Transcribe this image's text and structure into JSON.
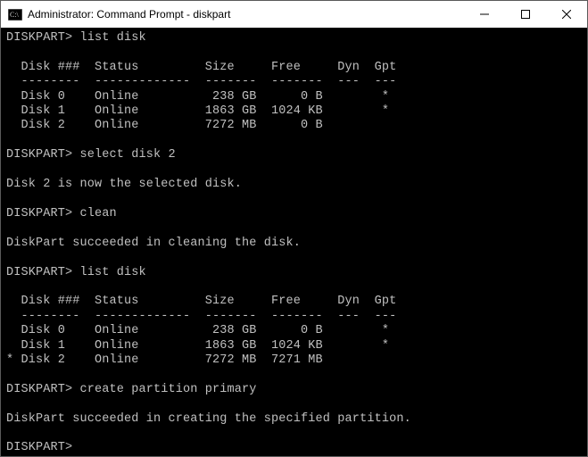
{
  "window": {
    "title": "Administrator: Command Prompt - diskpart"
  },
  "prompt": "DISKPART>",
  "session": {
    "cmd1": "list disk",
    "table1": {
      "header": "  Disk ###  Status         Size     Free     Dyn  Gpt",
      "divider": "  --------  -------------  -------  -------  ---  ---",
      "rows": [
        "  Disk 0    Online          238 GB      0 B        *",
        "  Disk 1    Online         1863 GB  1024 KB        *",
        "  Disk 2    Online         7272 MB      0 B"
      ]
    },
    "cmd2": "select disk 2",
    "msg2": "Disk 2 is now the selected disk.",
    "cmd3": "clean",
    "msg3": "DiskPart succeeded in cleaning the disk.",
    "cmd4": "list disk",
    "table2": {
      "header": "  Disk ###  Status         Size     Free     Dyn  Gpt",
      "divider": "  --------  -------------  -------  -------  ---  ---",
      "rows": [
        "  Disk 0    Online          238 GB      0 B        *",
        "  Disk 1    Online         1863 GB  1024 KB        *",
        "* Disk 2    Online         7272 MB  7271 MB"
      ]
    },
    "cmd5": "create partition primary",
    "msg5": "DiskPart succeeded in creating the specified partition."
  }
}
